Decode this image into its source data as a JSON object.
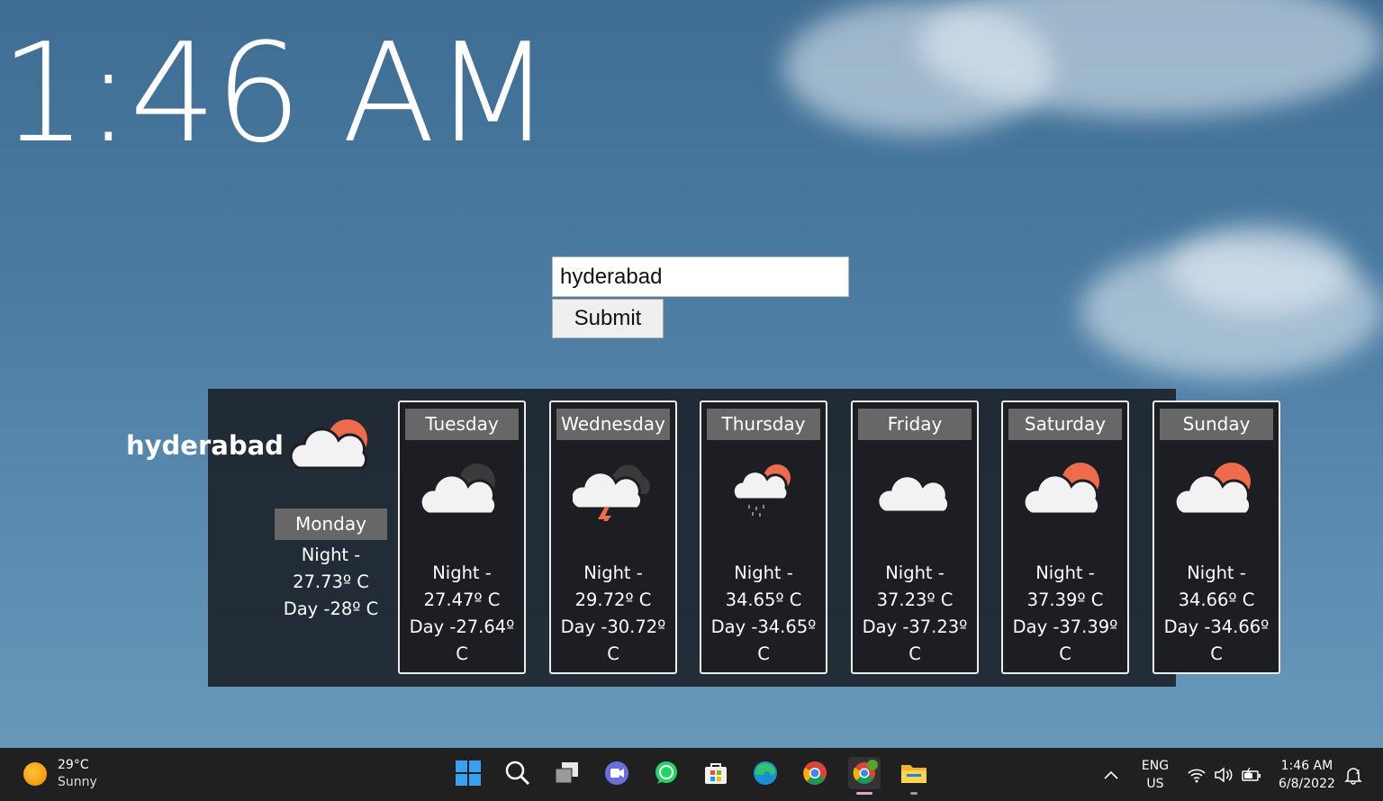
{
  "clock": {
    "time": "1:46 AM"
  },
  "search": {
    "value": "hyderabad",
    "submit_label": "Submit"
  },
  "weather": {
    "city": "hyderabad",
    "today": {
      "day": "Monday",
      "icon": "partly-cloudy-icon",
      "night": "Night -",
      "night_temp": "27.73º C",
      "day_temp": "Day -28º C"
    },
    "forecast": [
      {
        "day": "Tuesday",
        "icon": "cloudy-night-icon",
        "night": "Night -",
        "night_temp": "27.47º C",
        "day_temp": "Day -27.64º",
        "unit": "C"
      },
      {
        "day": "Wednesday",
        "icon": "thunderstorm-icon",
        "night": "Night -",
        "night_temp": "29.72º C",
        "day_temp": "Day -30.72º",
        "unit": "C"
      },
      {
        "day": "Thursday",
        "icon": "rain-icon",
        "night": "Night -",
        "night_temp": "34.65º C",
        "day_temp": "Day -34.65º",
        "unit": "C"
      },
      {
        "day": "Friday",
        "icon": "cloud-icon",
        "night": "Night -",
        "night_temp": "37.23º C",
        "day_temp": "Day -37.23º",
        "unit": "C"
      },
      {
        "day": "Saturday",
        "icon": "partly-cloudy-icon",
        "night": "Night -",
        "night_temp": "37.39º C",
        "day_temp": "Day -37.39º",
        "unit": "C"
      },
      {
        "day": "Sunday",
        "icon": "partly-cloudy-icon",
        "night": "Night -",
        "night_temp": "34.66º C",
        "day_temp": "Day -34.66º",
        "unit": "C"
      }
    ]
  },
  "taskbar": {
    "weather": {
      "temp": "29°C",
      "condition": "Sunny"
    },
    "apps": [
      "windows-start-icon",
      "search-icon",
      "task-view-icon",
      "teams-chat-icon",
      "whatsapp-icon",
      "microsoft-store-icon",
      "edge-icon",
      "chrome-icon",
      "chrome-profile-icon",
      "file-explorer-icon"
    ],
    "language": {
      "line1": "ENG",
      "line2": "US"
    },
    "time": "1:46 AM",
    "date": "6/8/2022"
  },
  "colors": {
    "panel": "#1a1f26",
    "label_bg": "#676767",
    "sun": "#ee6b4d",
    "cloud": "#f2f2f2"
  }
}
